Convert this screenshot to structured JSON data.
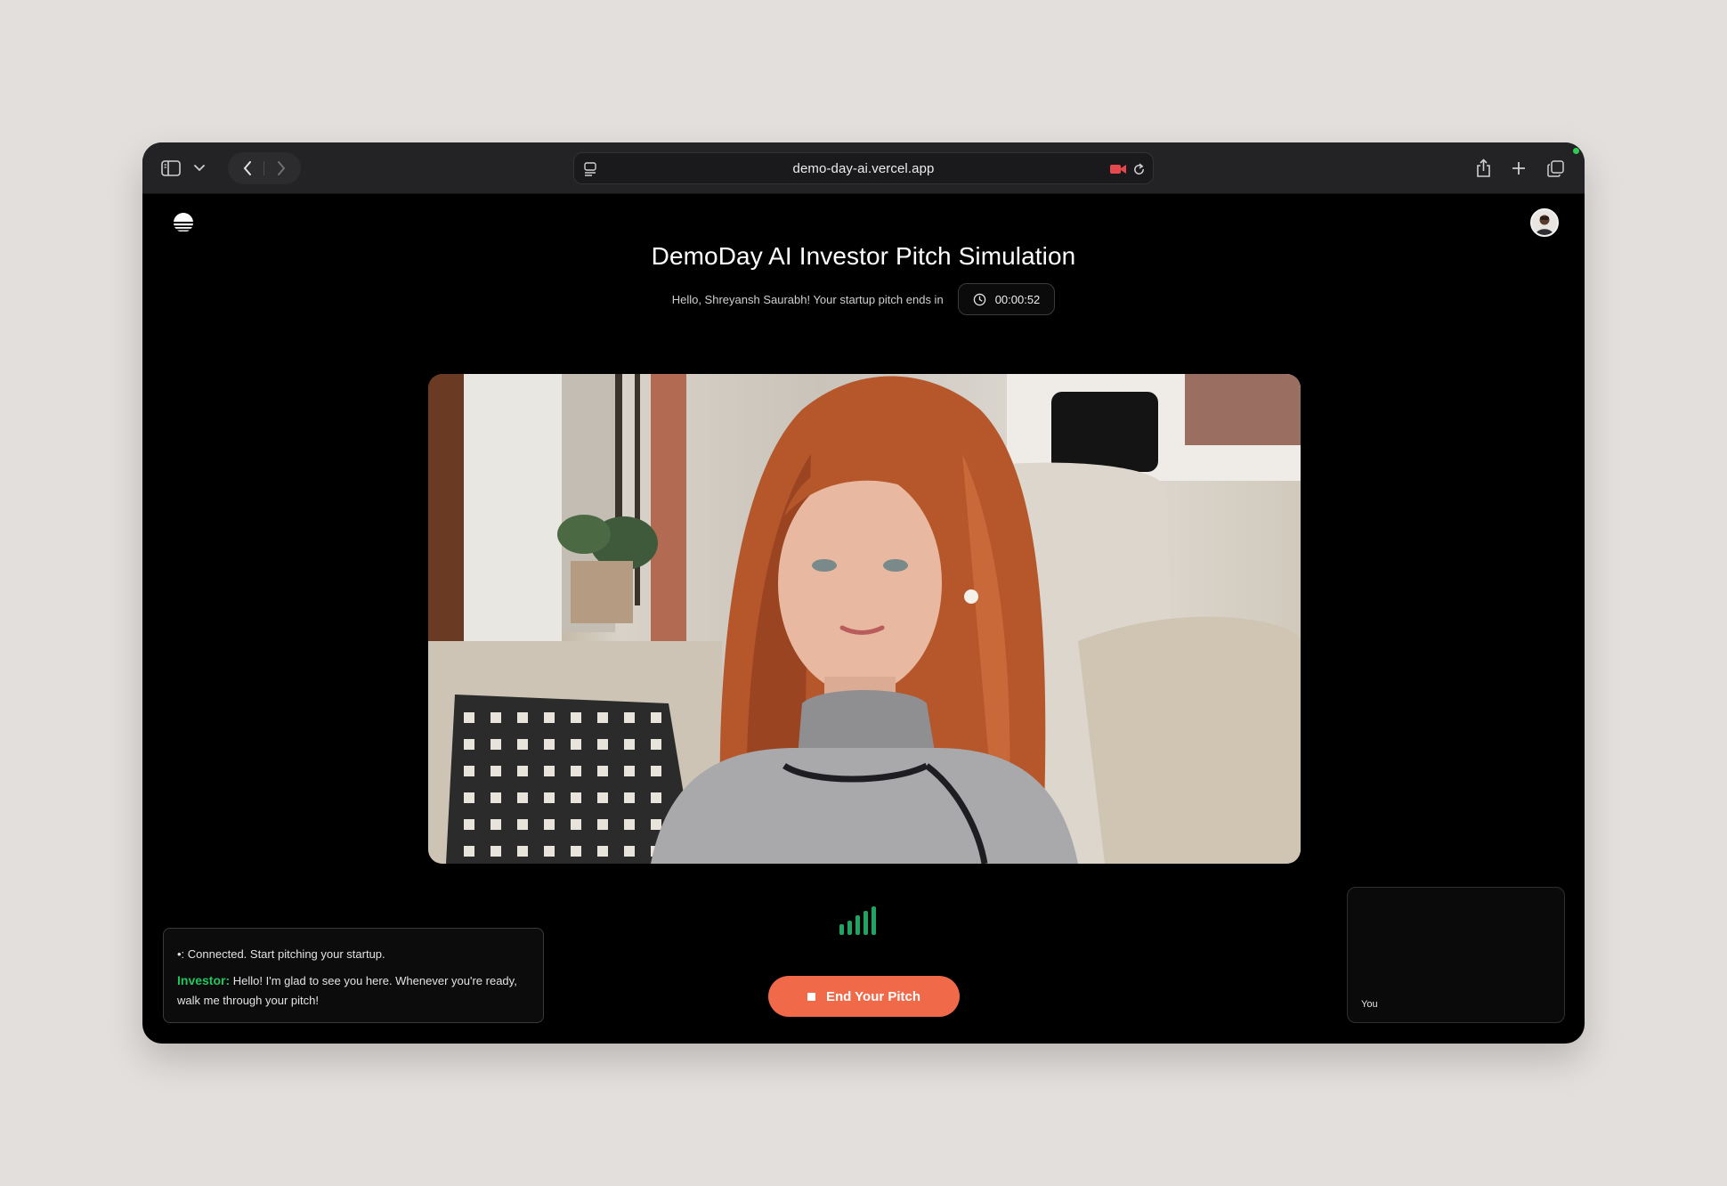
{
  "browser": {
    "url": "demo-day-ai.vercel.app",
    "recording_color": "#e5484d"
  },
  "header": {
    "title": "DemoDay AI Investor Pitch Simulation",
    "subtitle": "Hello, Shreyansh Saurabh! Your startup pitch ends in",
    "timer": "00:00:52"
  },
  "video": {
    "description_icon": "investor-video-feed"
  },
  "audio_levels": {
    "color": "#1fa563"
  },
  "controls": {
    "end_label": "End Your Pitch",
    "end_color": "#f06a4a"
  },
  "transcript": {
    "system_prefix": "•:",
    "system_text": "Connected. Start pitching your startup.",
    "speaker": "Investor:",
    "speaker_color": "#22c55e",
    "message": "Hello! I'm glad to see you here. Whenever you're ready, walk me through your pitch!"
  },
  "self_view": {
    "label": "You"
  }
}
